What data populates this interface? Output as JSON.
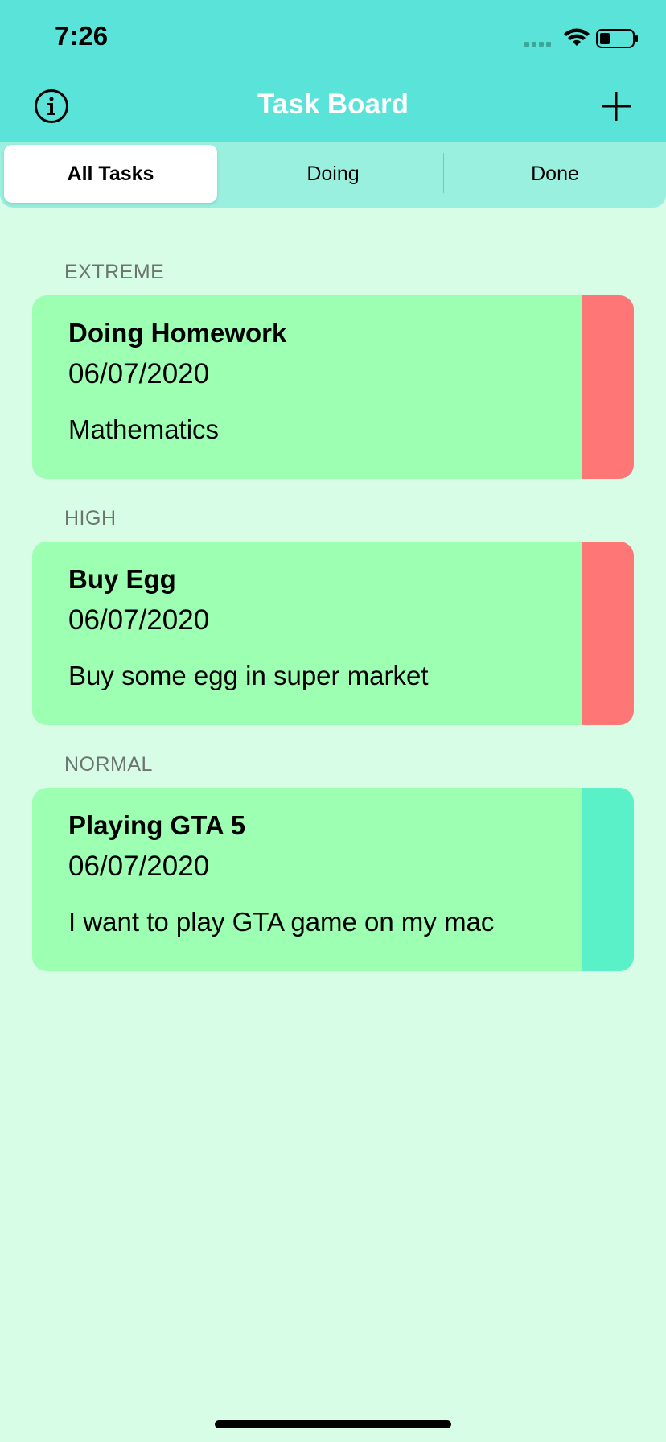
{
  "status_bar": {
    "time": "7:26",
    "icons": [
      "signal-icon",
      "wifi-icon",
      "battery-icon"
    ]
  },
  "nav": {
    "title": "Task Board",
    "left_icon": "info-icon",
    "right_icon": "plus-icon"
  },
  "tabs": [
    {
      "label": "All Tasks",
      "selected": true
    },
    {
      "label": "Doing",
      "selected": false
    },
    {
      "label": "Done",
      "selected": false
    }
  ],
  "sections": [
    {
      "header": "EXTREME",
      "task": {
        "title": "Doing Homework",
        "date": "06/07/2020",
        "note": "Mathematics",
        "priority_color": "#ff7676"
      }
    },
    {
      "header": "HIGH",
      "task": {
        "title": "Buy Egg",
        "date": "06/07/2020",
        "note": "Buy some egg in super market",
        "priority_color": "#ff7676"
      }
    },
    {
      "header": "NORMAL",
      "task": {
        "title": "Playing GTA 5",
        "date": "06/07/2020",
        "note": "I want to play GTA game on my mac",
        "priority_color": "#5af0c8"
      }
    }
  ],
  "colors": {
    "nav_background": "#5ae3d8",
    "page_background": "#d8fde6",
    "card_background": "#9dffb1",
    "segment_background": "#9af0df"
  }
}
